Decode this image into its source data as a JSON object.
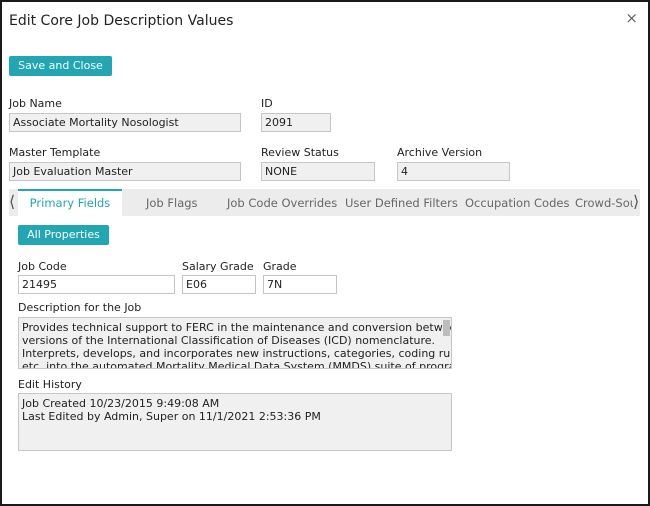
{
  "dialog": {
    "title": "Edit Core Job Description Values",
    "close_glyph": "×"
  },
  "toolbar": {
    "save_close_label": "Save and Close"
  },
  "header_fields": {
    "job_name": {
      "label": "Job Name",
      "value": "Associate Mortality Nosologist"
    },
    "id": {
      "label": "ID",
      "value": "2091"
    },
    "master_template": {
      "label": "Master Template",
      "value": "Job Evaluation Master"
    },
    "review_status": {
      "label": "Review Status",
      "value": "NONE"
    },
    "archive_version": {
      "label": "Archive Version",
      "value": "4"
    }
  },
  "tabs": {
    "prev_glyph": "⟨",
    "next_glyph": "⟩",
    "items": [
      {
        "label": "Primary Fields"
      },
      {
        "label": "Job Flags"
      },
      {
        "label": "Job Code Overrides"
      },
      {
        "label": "User Defined Filters"
      },
      {
        "label": "Occupation Codes"
      },
      {
        "label": "Crowd-Sou"
      }
    ]
  },
  "primary": {
    "all_properties_label": "All Properties",
    "job_code": {
      "label": "Job Code",
      "value": "21495"
    },
    "salary_grade": {
      "label": "Salary Grade",
      "value": "E06"
    },
    "grade": {
      "label": "Grade",
      "value": "7N"
    },
    "description": {
      "label": "Description for the Job",
      "lines": [
        "Provides technical support to FERC in the maintenance and conversion between",
        "versions of the International Classification of Diseases (ICD) nomenclature.",
        "Interprets, develops, and incorporates new instructions, categories, coding rules,",
        "etc. into the automated Mortality Medical Data System (MMDS) suite of programs"
      ]
    },
    "edit_history": {
      "label": "Edit History",
      "lines": [
        "Job Created 10/23/2015 9:49:08 AM",
        "Last Edited by Admin, Super on 11/1/2021 2:53:36 PM"
      ]
    }
  }
}
